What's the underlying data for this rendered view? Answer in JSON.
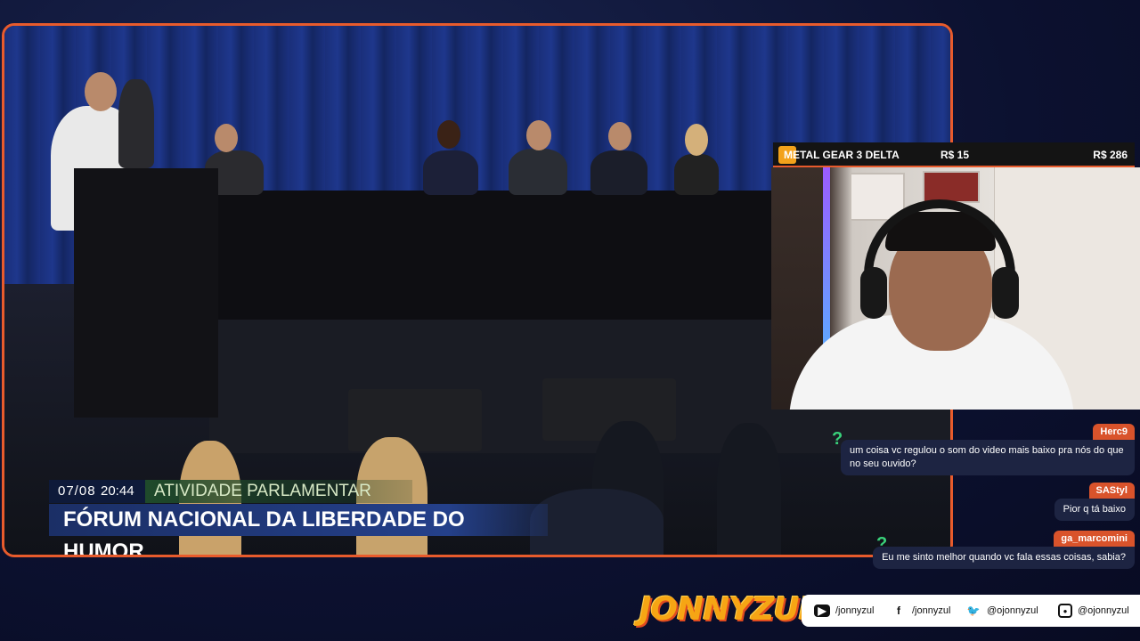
{
  "video": {
    "lower_third": {
      "date": "07/08",
      "time": "20:44",
      "category": "ATIVIDADE PARLAMENTAR",
      "title": "FÓRUM NACIONAL DA LIBERDADE DO HUMOR"
    }
  },
  "goal_bar": {
    "icon": "game-cover-icon",
    "name": "METAL GEAR 3 DELTA",
    "current": "R$ 15",
    "target": "R$ 286"
  },
  "chat": {
    "messages": [
      {
        "user": "Herc9",
        "user_color": "#d9532b",
        "text": "um coisa vc regulou o som do video mais baixo pra nós do que no seu ouvido?"
      },
      {
        "user": "SAStyl",
        "user_color": "#d9532b",
        "text": "Pior q tá baixo"
      },
      {
        "user": "ga_marcomini",
        "user_color": "#d9532b",
        "text": "Eu me sinto melhor quando vc fala essas coisas, sabia?"
      }
    ]
  },
  "branding": {
    "logo": "JONNYZUL",
    "socials": [
      {
        "icon": "youtube-icon",
        "handle": "/jonnyzul"
      },
      {
        "icon": "facebook-icon",
        "handle": "/jonnyzul"
      },
      {
        "icon": "twitter-icon",
        "handle": "@ojonnyzul"
      },
      {
        "icon": "instagram-icon",
        "handle": "@ojonnyzul"
      }
    ]
  },
  "colors": {
    "accent": "#e85b2c",
    "chat_bubble": "#1d2442",
    "goal_icon": "#f3a21b"
  }
}
